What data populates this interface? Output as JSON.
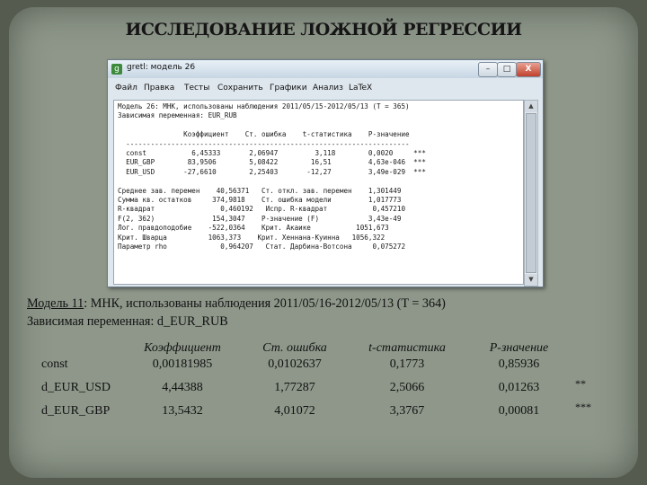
{
  "slide": {
    "title": "ИССЛЕДОВАНИЕ ЛОЖНОЙ РЕГРЕССИИ"
  },
  "window": {
    "title": "gretl: модель 26",
    "icon_name": "gretl-app-icon",
    "controls": [
      "–",
      "□",
      "X"
    ],
    "menu": [
      "Файл",
      "Правка",
      "Тесты",
      "Сохранить",
      "Графики",
      "Анализ",
      "LaTeX"
    ],
    "output_lines": [
      "Модель 26: МНК, использованы наблюдения 2011/05/15-2012/05/13 (T = 365)",
      "Зависимая переменная: EUR_RUB",
      "",
      "                Коэффициент    Ст. ошибка    t-статистика    P-значение",
      "  ---------------------------------------------------------------------",
      "  const           6,45333       2,06947         3,118        0,0020     ***",
      "  EUR_GBP        83,9506        5,08422        16,51         4,63e-046  ***",
      "  EUR_USD       -27,6610        2,25403       -12,27         3,49e-029  ***",
      "",
      "Среднее зав. перемен    40,56371   Ст. откл. зав. перемен    1,301449",
      "Сумма кв. остатков     374,9818    Ст. ошибка модели         1,017773",
      "R-квадрат                0,460192   Испр. R-квадрат           0,457210",
      "F(2, 362)              154,3047    Р-значение (F)            3,43e-49",
      "Лог. правдоподобие    -522,0364    Крит. Акаике           1051,673",
      "Крит. Шварца          1063,373    Крит. Хеннана-Куинна   1056,322",
      "Параметр rho             0,964207   Стат. Дарбина-Вотсона     0,075272"
    ]
  },
  "model": {
    "line1_prefix": "Модель 11",
    "line1_rest": ": МНК, использованы наблюдения 2011/05/16-2012/05/13 (T = 364)",
    "line2": "Зависимая переменная: d_EUR_RUB",
    "table": {
      "headers": [
        "Коэффициент",
        "Ст. ошибка",
        "t-статистика",
        "P-значение"
      ],
      "rows": [
        {
          "name": "const",
          "coef": "0,00181985",
          "se": "0,0102637",
          "t": "0,1773",
          "p": "0,85936",
          "stars": ""
        },
        {
          "name": "d_EUR_USD",
          "coef": "4,44388",
          "se": "1,77287",
          "t": "2,5066",
          "p": "0,01263",
          "stars": "**"
        },
        {
          "name": "d_EUR_GBP",
          "coef": "13,5432",
          "se": "4,01072",
          "t": "3,3767",
          "p": "0,00081",
          "stars": "***"
        }
      ]
    }
  }
}
